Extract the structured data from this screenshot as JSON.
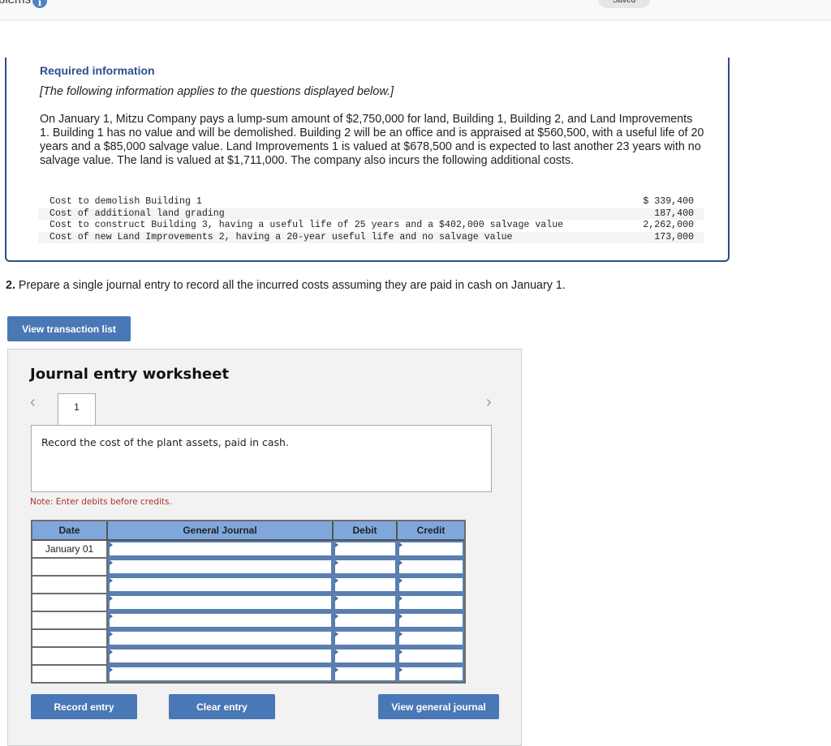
{
  "topbar": {
    "problems_label": "blems",
    "info_icon": "info-icon",
    "saved_label": "Saved"
  },
  "required_info": {
    "title": "Required information",
    "subtitle": "[The following information applies to the questions displayed below.]",
    "paragraph": "On January 1, Mitzu Company pays a lump-sum amount of $2,750,000 for land, Building 1, Building 2, and Land Improvements 1. Building 1 has no value and will be demolished. Building 2 will be an office and is appraised at $560,500, with a useful life of 20 years and a $85,000 salvage value. Land Improvements 1 is valued at $678,500 and is expected to last another 23 years with no salvage value. The land is valued at $1,711,000. The company also incurs the following additional costs.",
    "costs": [
      {
        "label": "Cost to demolish Building 1",
        "amount": "$ 339,400"
      },
      {
        "label": "Cost of additional land grading",
        "amount": "187,400"
      },
      {
        "label": "Cost to construct Building 3, having a useful life of 25 years and a $402,000 salvage value",
        "amount": "2,262,000"
      },
      {
        "label": "Cost of new Land Improvements 2, having a 20-year useful life and no salvage value",
        "amount": "173,000"
      }
    ]
  },
  "question": {
    "number": "2.",
    "text": " Prepare a single journal entry to record all the incurred costs assuming they are paid in cash on January 1."
  },
  "buttons": {
    "view_transaction_list": "View transaction list",
    "record_entry": "Record entry",
    "clear_entry": "Clear entry",
    "view_general_journal": "View general journal"
  },
  "worksheet": {
    "title": "Journal entry worksheet",
    "prev_icon": "‹",
    "next_icon": "›",
    "active_tab": "1",
    "description": "Record the cost of the plant assets, paid in cash.",
    "note": "Note: Enter debits before credits.",
    "columns": [
      "Date",
      "General Journal",
      "Debit",
      "Credit"
    ],
    "rows": [
      {
        "date": "January 01",
        "account": "",
        "debit": "",
        "credit": ""
      },
      {
        "date": "",
        "account": "",
        "debit": "",
        "credit": ""
      },
      {
        "date": "",
        "account": "",
        "debit": "",
        "credit": ""
      },
      {
        "date": "",
        "account": "",
        "debit": "",
        "credit": ""
      },
      {
        "date": "",
        "account": "",
        "debit": "",
        "credit": ""
      },
      {
        "date": "",
        "account": "",
        "debit": "",
        "credit": ""
      },
      {
        "date": "",
        "account": "",
        "debit": "",
        "credit": ""
      },
      {
        "date": "",
        "account": "",
        "debit": "",
        "credit": ""
      }
    ]
  }
}
